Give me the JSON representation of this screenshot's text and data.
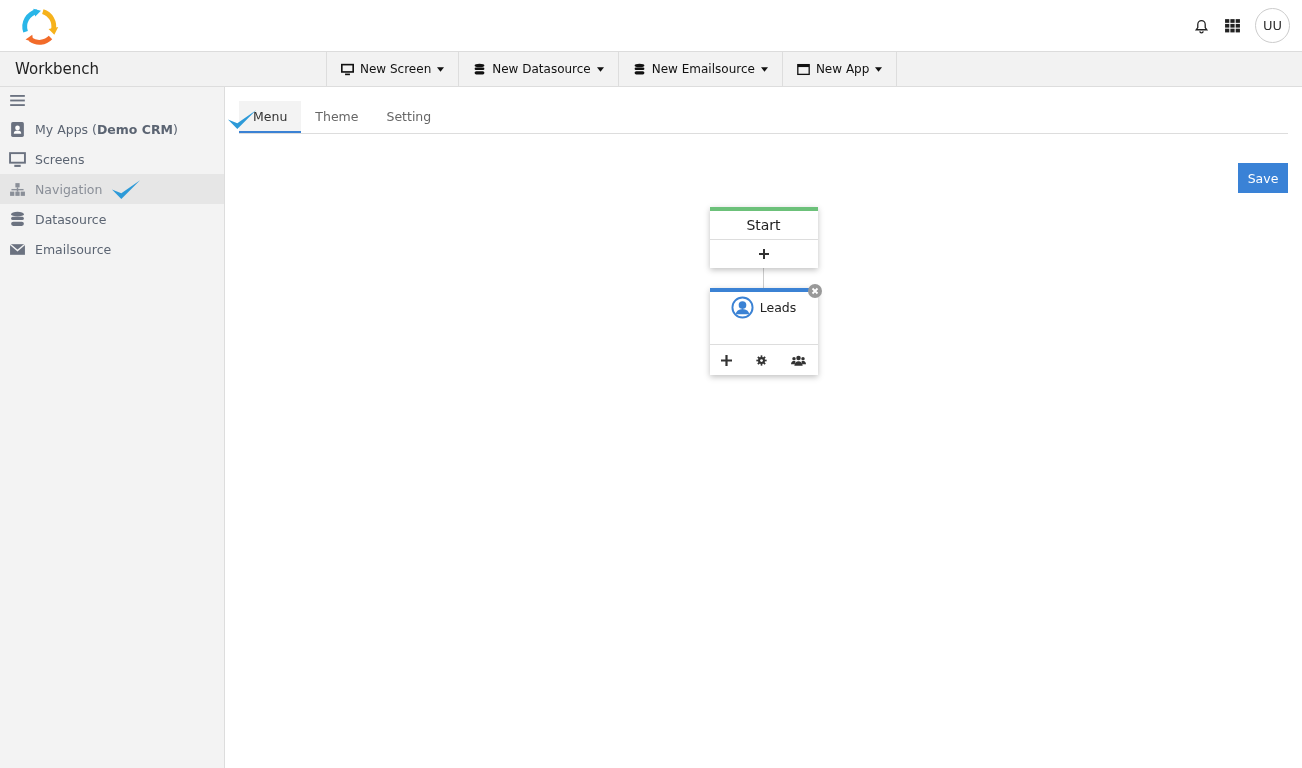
{
  "header": {
    "avatar": "UU"
  },
  "workbench": {
    "title": "Workbench"
  },
  "toolbar": [
    {
      "label": "New Screen",
      "kind": "monitor"
    },
    {
      "label": "New Datasource",
      "kind": "database"
    },
    {
      "label": "New Emailsource",
      "kind": "database"
    },
    {
      "label": "New App",
      "kind": "window"
    }
  ],
  "sidebar": {
    "items": [
      {
        "label": "My Apps (**Demo CRM**)",
        "kind": "contacts",
        "selected": false
      },
      {
        "label": "Screens",
        "kind": "monitor",
        "selected": false
      },
      {
        "label": "Navigation",
        "kind": "sitemap",
        "selected": true
      },
      {
        "label": "Datasource",
        "kind": "database",
        "selected": false
      },
      {
        "label": "Emailsource",
        "kind": "envelope",
        "selected": false
      }
    ]
  },
  "tabs": [
    {
      "label": "Menu",
      "selected": true
    },
    {
      "label": "Theme",
      "selected": false
    },
    {
      "label": "Setting",
      "selected": false
    }
  ],
  "save_button": "Save",
  "flow": {
    "start": {
      "title": "Start"
    },
    "screens": [
      {
        "title": "Leads"
      }
    ]
  }
}
